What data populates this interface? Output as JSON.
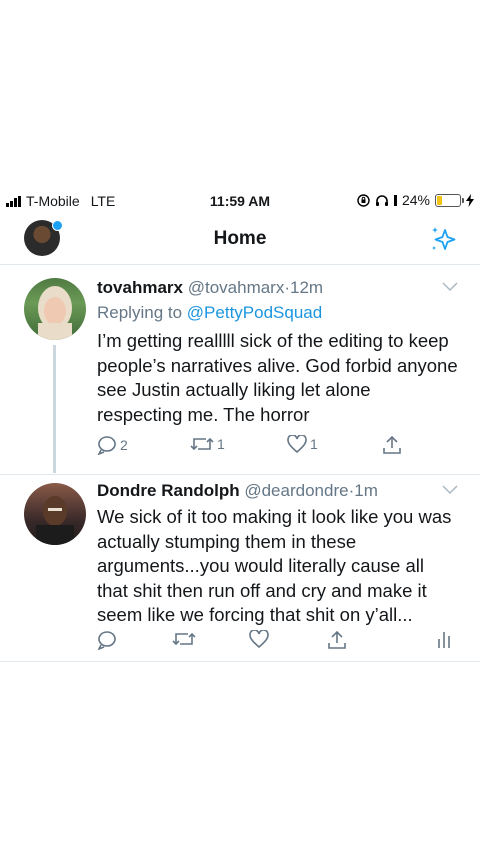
{
  "status": {
    "carrier": "T-Mobile",
    "network": "LTE",
    "time": "11:59 AM",
    "battery": "24%",
    "battery_level": 0.24
  },
  "header": {
    "title": "Home",
    "sparkle_icon": "sparkle-icon"
  },
  "tweets": [
    {
      "display_name": "tovahmarx",
      "handle": "@tovahmarx",
      "separator": "·",
      "time": "12m",
      "reply_prefix": "Replying to",
      "reply_to": "@PettyPodSquad",
      "text": "I’m getting realllll sick of the editing to keep people’s narratives alive. God forbid anyone see Justin actually liking let alone respecting me. The horror",
      "replies": "2",
      "retweets": "1",
      "likes": "1"
    },
    {
      "display_name": "Dondre Randolph",
      "handle": "@deardondre",
      "separator": "·",
      "time": "1m",
      "text": "We sick of it too making it look like you was actually stumping them in these arguments...you would literally cause all that shit then run off and cry and make it seem like we forcing that shit on y’all..."
    }
  ],
  "colors": {
    "accent": "#1da1f2",
    "link": "#1b95e0",
    "muted": "#657786"
  }
}
